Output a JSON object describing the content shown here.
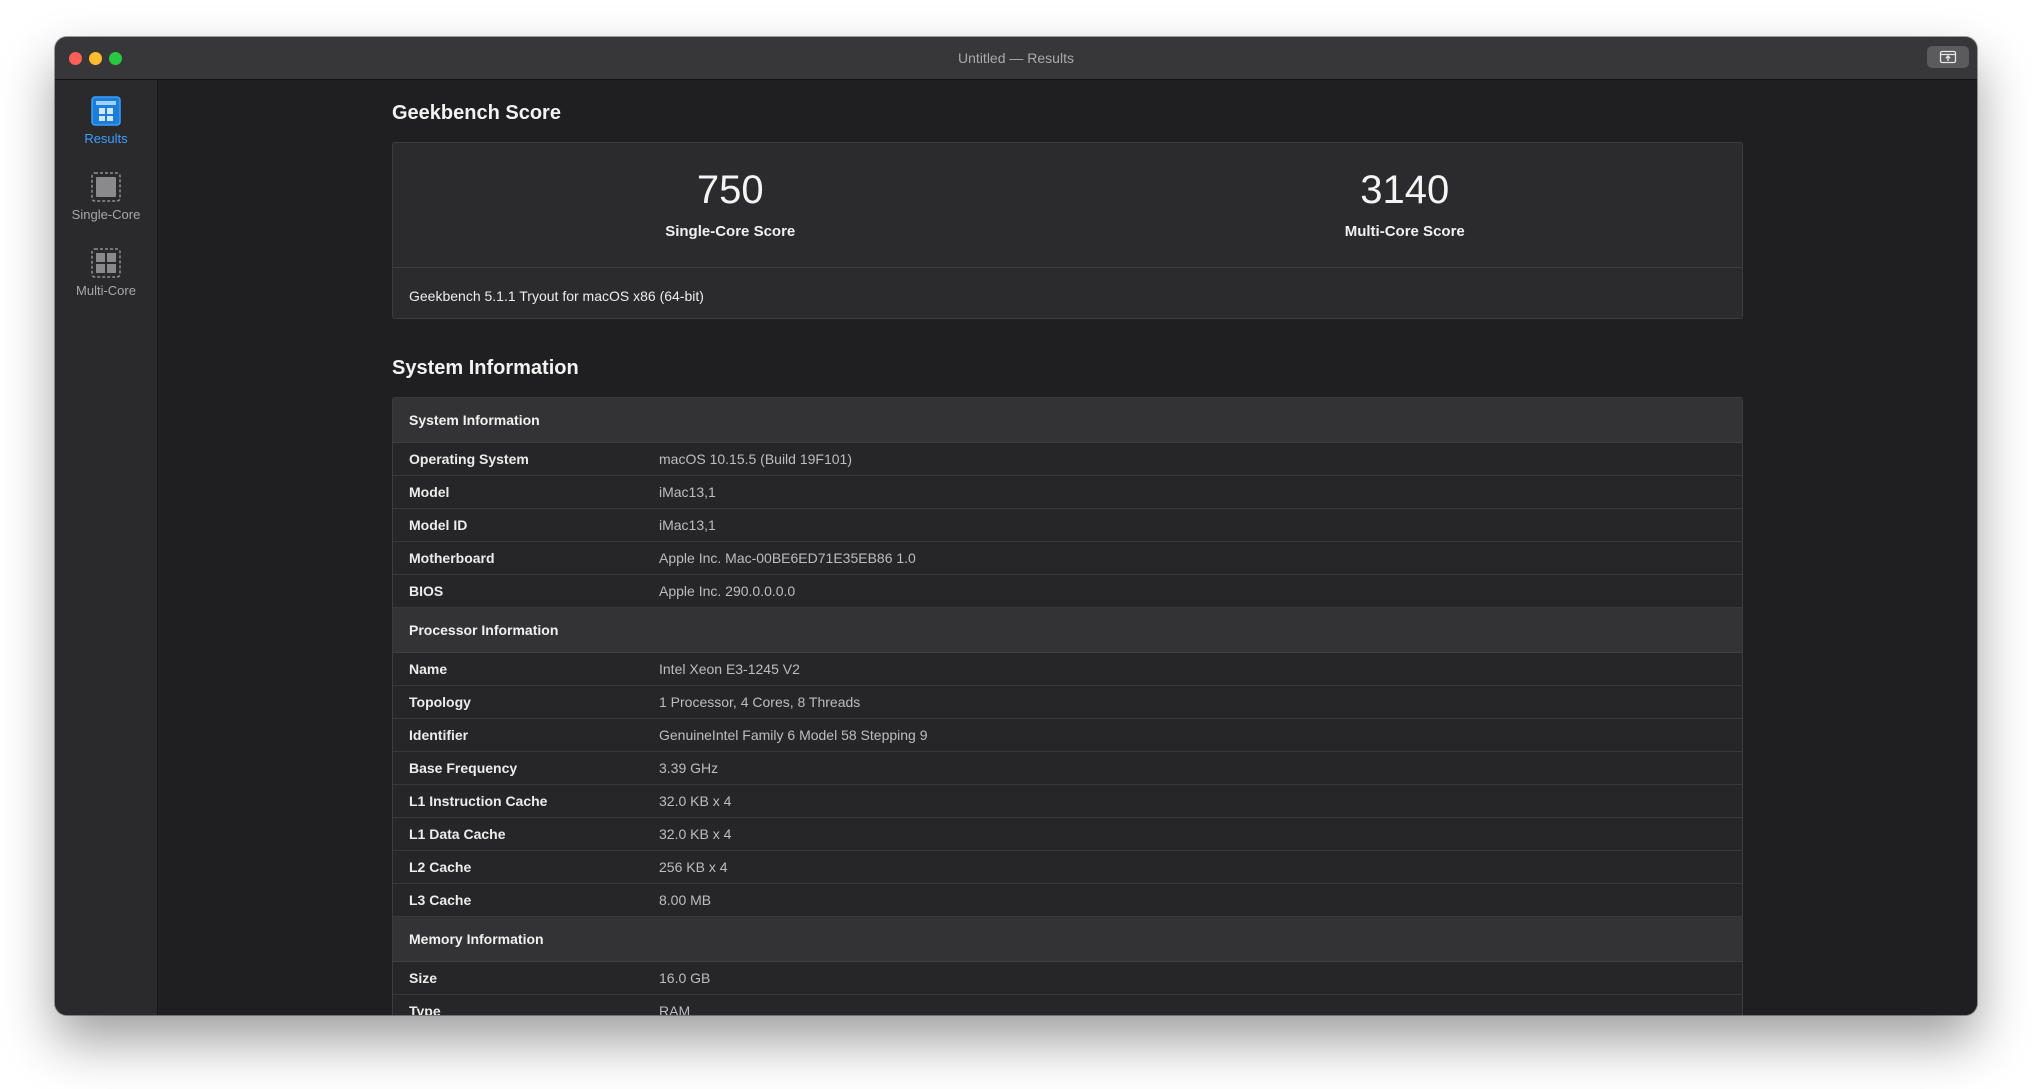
{
  "window": {
    "title": "Untitled — Results"
  },
  "sidebar": {
    "items": [
      {
        "label": "Results",
        "icon": "results-icon",
        "active": true
      },
      {
        "label": "Single-Core",
        "icon": "single-core-icon",
        "active": false
      },
      {
        "label": "Multi-Core",
        "icon": "multi-core-icon",
        "active": false
      }
    ]
  },
  "score_section": {
    "title": "Geekbench Score",
    "single_core": {
      "value": "750",
      "label": "Single-Core Score"
    },
    "multi_core": {
      "value": "3140",
      "label": "Multi-Core Score"
    },
    "version": "Geekbench 5.1.1 Tryout for macOS x86 (64-bit)"
  },
  "system_section": {
    "title": "System Information",
    "groups": [
      {
        "header": "System Information",
        "rows": [
          {
            "key": "Operating System",
            "value": "macOS 10.15.5 (Build 19F101)"
          },
          {
            "key": "Model",
            "value": "iMac13,1"
          },
          {
            "key": "Model ID",
            "value": "iMac13,1"
          },
          {
            "key": "Motherboard",
            "value": "Apple Inc. Mac-00BE6ED71E35EB86 1.0"
          },
          {
            "key": "BIOS",
            "value": "Apple Inc. 290.0.0.0.0"
          }
        ]
      },
      {
        "header": "Processor Information",
        "rows": [
          {
            "key": "Name",
            "value": "Intel Xeon E3-1245 V2"
          },
          {
            "key": "Topology",
            "value": "1 Processor, 4 Cores, 8 Threads"
          },
          {
            "key": "Identifier",
            "value": "GenuineIntel Family 6 Model 58 Stepping 9"
          },
          {
            "key": "Base Frequency",
            "value": "3.39 GHz"
          },
          {
            "key": "L1 Instruction Cache",
            "value": "32.0 KB x 4"
          },
          {
            "key": "L1 Data Cache",
            "value": "32.0 KB x 4"
          },
          {
            "key": "L2 Cache",
            "value": "256 KB x 4"
          },
          {
            "key": "L3 Cache",
            "value": "8.00 MB"
          }
        ]
      },
      {
        "header": "Memory Information",
        "rows": [
          {
            "key": "Size",
            "value": "16.0 GB"
          },
          {
            "key": "Type",
            "value": "RAM"
          }
        ]
      }
    ]
  },
  "colors": {
    "accent": "#3aa0ff",
    "window_bg": "#1f1f21",
    "sidebar_bg": "#2a2a2c"
  }
}
